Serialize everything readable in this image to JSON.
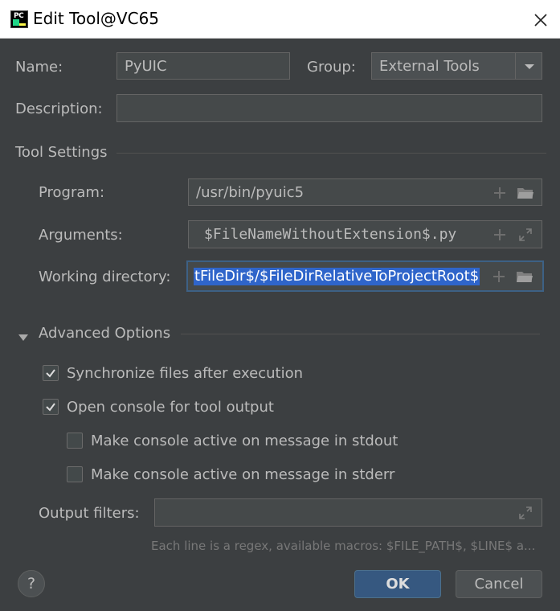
{
  "window": {
    "title": "Edit Tool@VC65",
    "app_icon_text": "PC"
  },
  "form": {
    "name_label": "Name:",
    "name_value": "PyUIC",
    "group_label": "Group:",
    "group_value": "External Tools",
    "description_label": "Description:",
    "description_value": ""
  },
  "tool_settings": {
    "header": "Tool Settings",
    "program_label": "Program:",
    "program_value": "/usr/bin/pyuic5",
    "arguments_label": "Arguments:",
    "arguments_value": "$FileNameWithoutExtension$.py",
    "workdir_label": "Working directory:",
    "workdir_value": "tFileDir$/$FileDirRelativeToProjectRoot$"
  },
  "advanced": {
    "header": "Advanced Options",
    "options": [
      {
        "label": "Synchronize files after execution",
        "checked": true
      },
      {
        "label": "Open console for tool output",
        "checked": true
      },
      {
        "label": "Make console active on message in stdout",
        "checked": false
      },
      {
        "label": "Make console active on message in stderr",
        "checked": false
      }
    ],
    "output_filters_label": "Output filters:",
    "output_filters_value": "",
    "hint": "Each line is a regex, available macros: $FILE_PATH$, $LINE$ a..."
  },
  "footer": {
    "help_label": "?",
    "ok_label": "OK",
    "cancel_label": "Cancel"
  },
  "colors": {
    "background": "#3c3f41",
    "field": "#45494a",
    "selection": "#2f65ca",
    "ok_button": "#365880",
    "focus_border": "#3d6185"
  }
}
